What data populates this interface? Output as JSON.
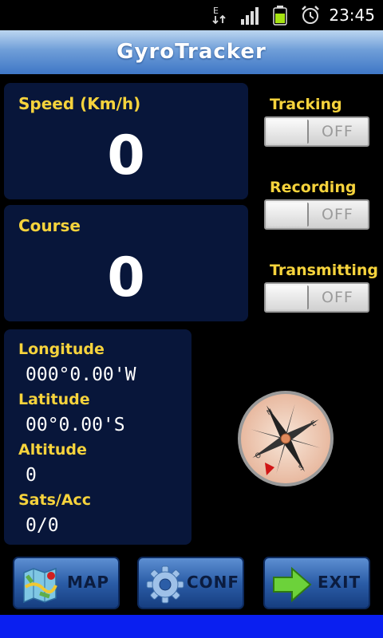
{
  "status_bar": {
    "time": "23:45",
    "network": "E",
    "icons": [
      "data-arrows-icon",
      "signal-icon",
      "battery-icon",
      "alarm-icon"
    ]
  },
  "app": {
    "title": "GyroTracker"
  },
  "speed": {
    "label": "Speed (Km/h)",
    "value": "0"
  },
  "course": {
    "label": "Course",
    "value": "0"
  },
  "position": {
    "longitude_label": "Longitude",
    "longitude_value": "000°0.00'W",
    "latitude_label": "Latitude",
    "latitude_value": "00°0.00'S",
    "altitude_label": "Altitude",
    "altitude_value": "0",
    "sats_label": "Sats/Acc",
    "sats_value": "0/0"
  },
  "toggles": {
    "tracking": {
      "label": "Tracking",
      "state": "OFF"
    },
    "recording": {
      "label": "Recording",
      "state": "OFF"
    },
    "transmitting": {
      "label": "Transmitting",
      "state": "OFF"
    }
  },
  "compass": {
    "letters": [
      "N",
      "E",
      "S",
      "O"
    ]
  },
  "buttons": {
    "map": "MAP",
    "conf": "CONF",
    "exit": "EXIT"
  },
  "colors": {
    "label_yellow": "#f6d33c",
    "panel_bg": "#08163a",
    "title_gradient_top": "#bcd6f0",
    "title_gradient_bottom": "#3f77c6",
    "bottom_bar": "#0a1ff0"
  }
}
